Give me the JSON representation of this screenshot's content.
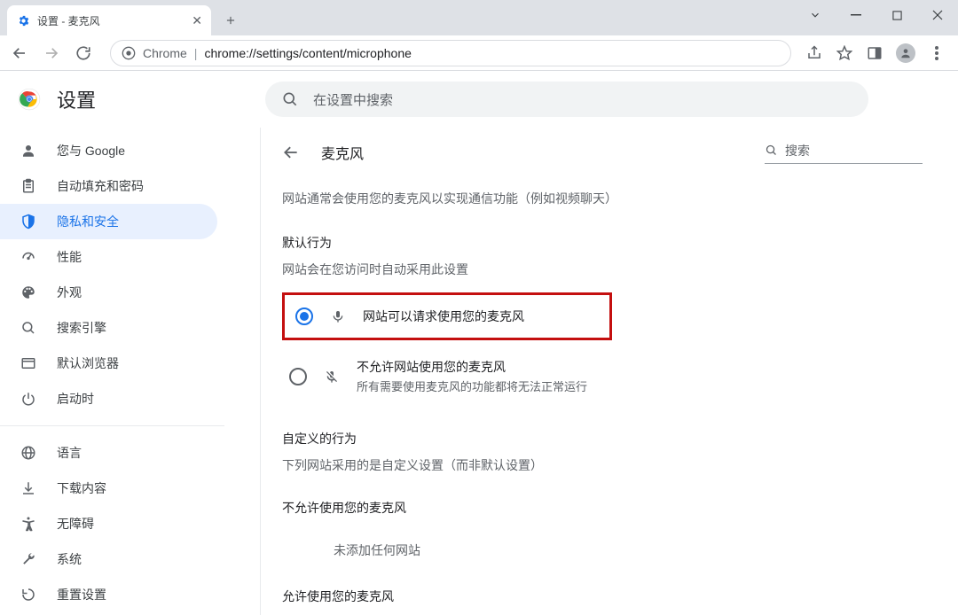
{
  "window": {
    "tab_title": "设置 - 麦克风"
  },
  "address": {
    "label": "Chrome",
    "url": "chrome://settings/content/microphone"
  },
  "app": {
    "title": "设置",
    "search_placeholder": "在设置中搜索"
  },
  "sidebar": {
    "items": [
      {
        "label": "您与 Google"
      },
      {
        "label": "自动填充和密码"
      },
      {
        "label": "隐私和安全"
      },
      {
        "label": "性能"
      },
      {
        "label": "外观"
      },
      {
        "label": "搜索引擎"
      },
      {
        "label": "默认浏览器"
      },
      {
        "label": "启动时"
      }
    ],
    "items2": [
      {
        "label": "语言"
      },
      {
        "label": "下载内容"
      },
      {
        "label": "无障碍"
      },
      {
        "label": "系统"
      },
      {
        "label": "重置设置"
      }
    ]
  },
  "main": {
    "title": "麦克风",
    "search_placeholder": "搜索",
    "description": "网站通常会使用您的麦克风以实现通信功能（例如视频聊天）",
    "default_section": {
      "title": "默认行为",
      "subtitle": "网站会在您访问时自动采用此设置",
      "options": [
        {
          "label": "网站可以请求使用您的麦克风"
        },
        {
          "label": "不允许网站使用您的麦克风",
          "sub": "所有需要使用麦克风的功能都将无法正常运行"
        }
      ]
    },
    "custom_section": {
      "title": "自定义的行为",
      "subtitle": "下列网站采用的是自定义设置（而非默认设置）"
    },
    "block_section": {
      "title": "不允许使用您的麦克风",
      "empty": "未添加任何网站"
    },
    "allow_section": {
      "title": "允许使用您的麦克风"
    }
  }
}
